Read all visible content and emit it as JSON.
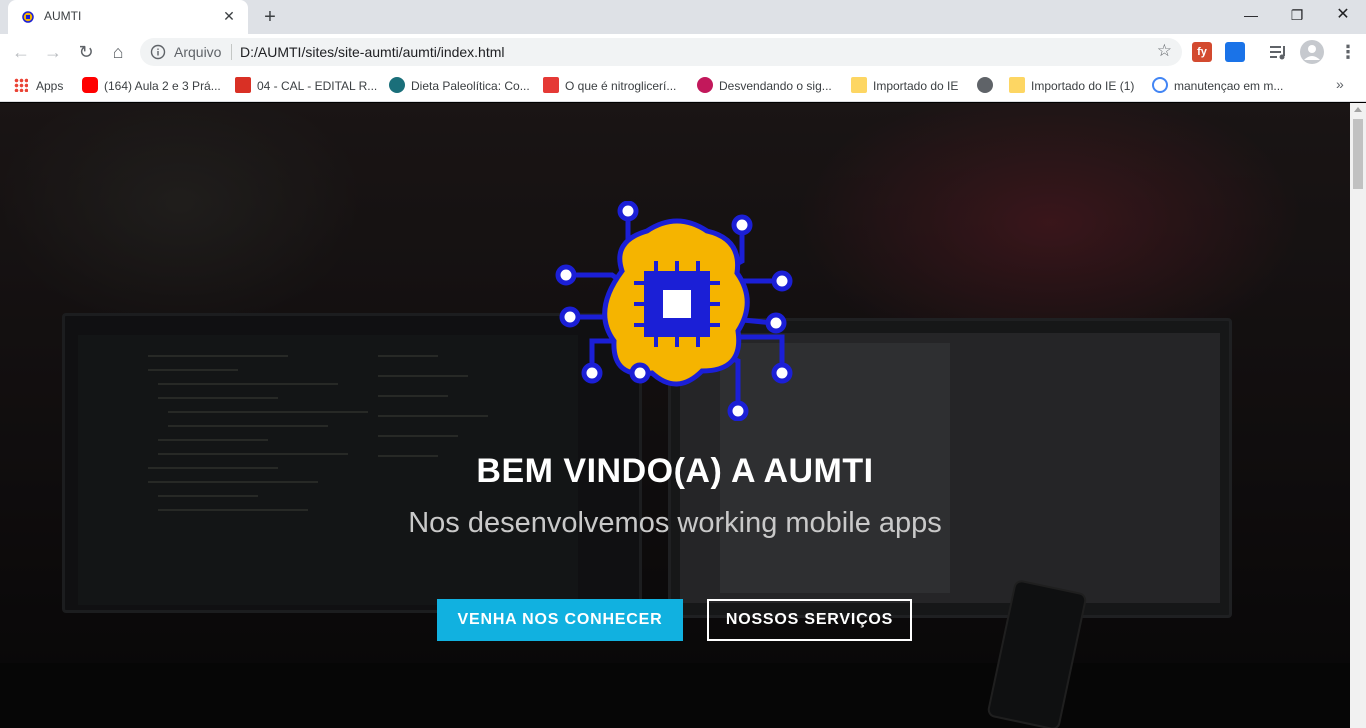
{
  "tab": {
    "title": "AUMTI",
    "close_glyph": "✕",
    "favicon": "robot-brain-icon"
  },
  "new_tab_glyph": "+",
  "window_controls": {
    "minimize": "—",
    "maximize": "❐",
    "close": "✕"
  },
  "toolbar": {
    "back_glyph": "←",
    "forward_glyph": "→",
    "reload_glyph": "↻",
    "home_glyph": "⌂",
    "scheme_label": "Arquivo",
    "url": "D:/AUMTI/sites/site-aumti/aumti/index.html",
    "star_glyph": "☆",
    "ext_fy_label": "fy",
    "menu_glyph": "⋮"
  },
  "bookmarks": [
    {
      "label": "Apps",
      "icon": "apps-grid-icon"
    },
    {
      "label": "(164) Aula 2 e 3 Prá...",
      "icon": "youtube-icon",
      "color": "#ff0000"
    },
    {
      "label": "04 - CAL - EDITAL R...",
      "icon": "pdf-icon",
      "color": "#d93025"
    },
    {
      "label": "Dieta Paleolítica: Co...",
      "icon": "dr-icon",
      "color": "#1a6f7a"
    },
    {
      "label": "O que é nitroglicerí...",
      "icon": "s-icon",
      "color": "#e53935"
    },
    {
      "label": "Desvendando o sig...",
      "icon": "spiral-icon",
      "color": "#c2185b"
    },
    {
      "label": "Importado do IE",
      "icon": "folder-icon",
      "color": "#fdd663"
    },
    {
      "label": "",
      "icon": "globe-icon",
      "color": "#5f6368"
    },
    {
      "label": "Importado do IE (1)",
      "icon": "folder-icon",
      "color": "#fdd663"
    },
    {
      "label": "manutençao em m...",
      "icon": "google-icon",
      "color": "#4285f4"
    }
  ],
  "bookmarks_more_glyph": "»",
  "hero": {
    "title": "BEM VINDO(A) A AUMTI",
    "subtitle": "Nos desenvolvemos working mobile apps",
    "primary_button": "VENHA NOS CONHECER",
    "secondary_button": "NOSSOS SERVIÇOS"
  },
  "colors": {
    "accent": "#11b1e0",
    "logo_blue": "#1b1fd6",
    "logo_gold": "#f5b400"
  }
}
